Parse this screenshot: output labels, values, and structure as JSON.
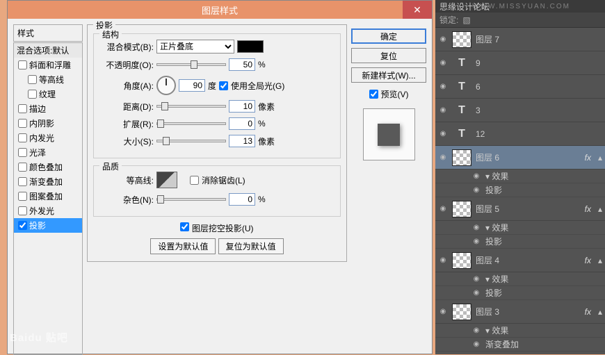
{
  "dialog": {
    "title": "图层样式",
    "close": "✕",
    "styles_header": "样式",
    "styles": [
      {
        "label": "混合选项:默认",
        "blend": true
      },
      {
        "label": "斜面和浮雕",
        "cb": true
      },
      {
        "label": "等高线",
        "cb": true,
        "indent": true
      },
      {
        "label": "纹理",
        "cb": true,
        "indent": true
      },
      {
        "label": "描边",
        "cb": true
      },
      {
        "label": "内阴影",
        "cb": true
      },
      {
        "label": "内发光",
        "cb": true
      },
      {
        "label": "光泽",
        "cb": true
      },
      {
        "label": "颜色叠加",
        "cb": true
      },
      {
        "label": "渐变叠加",
        "cb": true
      },
      {
        "label": "图案叠加",
        "cb": true
      },
      {
        "label": "外发光",
        "cb": true
      },
      {
        "label": "投影",
        "cb": true,
        "checked": true,
        "selected": true
      }
    ],
    "panel_title": "投影",
    "struct_title": "结构",
    "blend_mode_label": "混合模式(B):",
    "blend_mode_value": "正片叠底",
    "opacity_label": "不透明度(O):",
    "opacity_value": "50",
    "angle_label": "角度(A):",
    "angle_value": "90",
    "angle_unit": "度",
    "global_light": "使用全局光(G)",
    "distance_label": "距离(D):",
    "distance_value": "10",
    "spread_label": "扩展(R):",
    "spread_value": "0",
    "size_label": "大小(S):",
    "size_value": "13",
    "px": "像素",
    "pct": "%",
    "quality_title": "品质",
    "contour_label": "等高线:",
    "antialias": "消除锯齿(L)",
    "noise_label": "杂色(N):",
    "noise_value": "0",
    "knockout": "图层挖空投影(U)",
    "set_default": "设置为默认值",
    "reset_default": "复位为默认值"
  },
  "buttons": {
    "ok": "确定",
    "cancel": "复位",
    "new_style": "新建样式(W)...",
    "preview": "预览(V)"
  },
  "panel": {
    "hdr": "思缘设计论坛",
    "url": "WWW.MISSYUAN.COM",
    "lock": "锁定:"
  },
  "layers": [
    {
      "type": "img",
      "name": "图层 7"
    },
    {
      "type": "text",
      "name": "9"
    },
    {
      "type": "text",
      "name": "6"
    },
    {
      "type": "text",
      "name": "3"
    },
    {
      "type": "text",
      "name": "12"
    },
    {
      "type": "img",
      "name": "图层 6",
      "selected": true,
      "fx": true,
      "subs": [
        "效果",
        "投影"
      ]
    },
    {
      "type": "img",
      "name": "图层 5",
      "fx": true,
      "subs": [
        "效果",
        "投影"
      ]
    },
    {
      "type": "img",
      "name": "图层 4",
      "fx": true,
      "subs": [
        "效果",
        "投影"
      ]
    },
    {
      "type": "img",
      "name": "图层 3",
      "fx": true,
      "subs": [
        "效果",
        "渐变叠加"
      ]
    }
  ],
  "watermark": "Baidu 贴吧"
}
